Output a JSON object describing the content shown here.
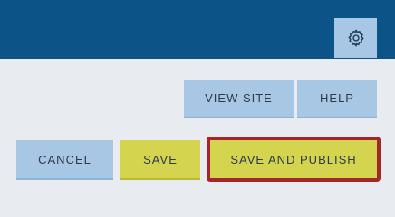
{
  "header": {
    "settings_icon": "gear-icon"
  },
  "toolbar": {
    "view_site_label": "VIEW SITE",
    "help_label": "HELP"
  },
  "actions": {
    "cancel_label": "CANCEL",
    "save_label": "SAVE",
    "save_publish_label": "SAVE AND PUBLISH"
  },
  "colors": {
    "header": "#0c5488",
    "button_blue": "#a8c7e4",
    "button_yellow": "#d4d44e",
    "highlight_outline": "#a3262b",
    "background": "#e8ecf1"
  }
}
